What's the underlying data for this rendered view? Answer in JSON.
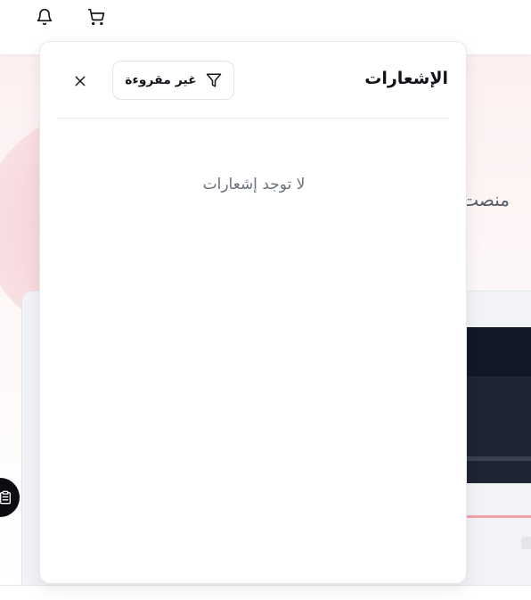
{
  "topbar": {
    "icons": [
      "bell-icon",
      "cart-icon"
    ]
  },
  "background": {
    "heading_fragment": "منصت"
  },
  "notifications": {
    "title": "الإشعارات",
    "filter_label": "غير مقروءة",
    "empty_message": "لا توجد إشعارات"
  },
  "colors": {
    "accent_pink": "#f6cdd2",
    "text_dark": "#111318",
    "text_muted": "#6b717c"
  }
}
